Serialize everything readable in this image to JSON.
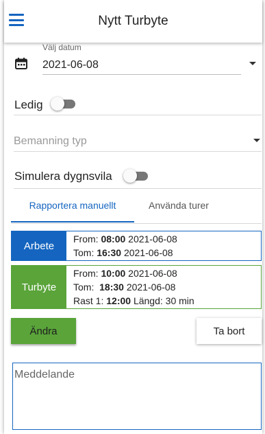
{
  "header": {
    "title": "Nytt Turbyte",
    "menu_icon": "hamburger-menu-icon"
  },
  "date": {
    "label": "Välj datum",
    "value": "2021-06-08",
    "icon": "calendar-icon"
  },
  "toggles": {
    "ledig": {
      "label": "Ledig",
      "on": false
    },
    "simulera": {
      "label": "Simulera dygnsvila",
      "on": false
    }
  },
  "bemanning": {
    "placeholder": "Bemanning typ"
  },
  "tabs": [
    {
      "label": "Rapportera manuellt",
      "active": true
    },
    {
      "label": "Använda turer",
      "active": false
    }
  ],
  "shifts": [
    {
      "tag": "Arbete",
      "color": "#1565c0",
      "from_prefix": "From:",
      "from_time": "08:00",
      "from_date": "2021-06-08",
      "to_prefix": "Tom:",
      "to_time": "16:30",
      "to_date": "2021-06-08"
    },
    {
      "tag": "Turbyte",
      "color": "#5aa43a",
      "from_prefix": "From:",
      "from_time": "10:00",
      "from_date": "2021-06-08",
      "to_prefix": "Tom:",
      "to_time": "18:30",
      "to_date": "2021-06-08",
      "rast_prefix": "Rast 1:",
      "rast_time": "12:00",
      "rast_length": "Längd: 30 min"
    }
  ],
  "buttons": {
    "edit": "Ändra",
    "delete": "Ta bort"
  },
  "message": {
    "placeholder": "Meddelande"
  }
}
